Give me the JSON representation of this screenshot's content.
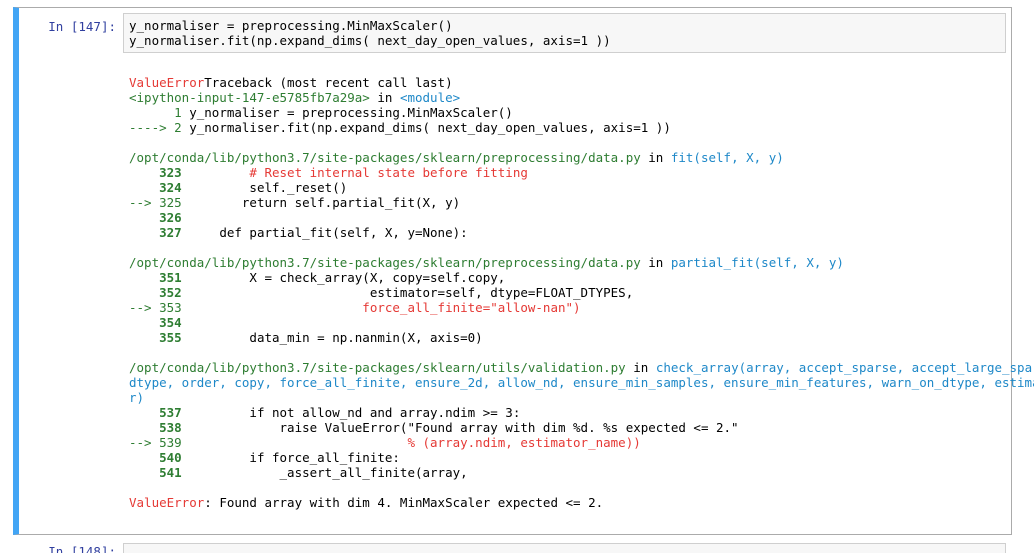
{
  "cell": {
    "prompt": "In [147]:",
    "input_lines": [
      "y_normaliser = preprocessing.MinMaxScaler()",
      "y_normaliser.fit(np.expand_dims( next_day_open_values, axis=1 ))"
    ]
  },
  "traceback": {
    "header_error": "ValueError",
    "header_text": "Traceback (most recent call last)",
    "input_ref": "<ipython-input-147-e5785fb7a29a>",
    "in_kw": " in ",
    "module": "<module>",
    "l1_num": "      1",
    "l1_code": " y_normaliser = preprocessing.MinMaxScaler()",
    "l2_arrow": "----> 2",
    "l2_code": " y_normaliser.fit(np.expand_dims( next_day_open_values, axis=1 ))",
    "f1_path": "/opt/conda/lib/python3.7/site-packages/sklearn/preprocessing/data.py",
    "f1_func": "fit(self, X, y)",
    "f1_323n": "    323",
    "f1_323c": "         # Reset internal state before fitting",
    "f1_324n": "    324",
    "f1_324c": "         self._reset()",
    "f1_325a": "--> 325",
    "f1_325c": "        return self.partial_fit(X, y)",
    "f1_326n": "    326",
    "f1_327n": "    327",
    "f1_327c": "     def partial_fit(self, X, y=None):",
    "f2_path": "/opt/conda/lib/python3.7/site-packages/sklearn/preprocessing/data.py",
    "f2_func": "partial_fit(self, X, y)",
    "f2_351n": "    351",
    "f2_351c": "         X = check_array(X, copy=self.copy,",
    "f2_352n": "    352",
    "f2_352c": "                         estimator=self, dtype=FLOAT_DTYPES,",
    "f2_353a": "--> 353",
    "f2_353c": "                        force_all_finite=\"allow-nan\")",
    "f2_354n": "    354",
    "f2_355n": "    355",
    "f2_355c": "         data_min = np.nanmin(X, axis=0)",
    "f3_path": "/opt/conda/lib/python3.7/site-packages/sklearn/utils/validation.py",
    "f3_func_l1": "check_array(array, accept_sparse, accept_large_sparse,",
    "f3_func_l2": "dtype, order, copy, force_all_finite, ensure_2d, allow_nd, ensure_min_samples, ensure_min_features, warn_on_dtype, estimato",
    "f3_func_l3": "r)",
    "f3_537n": "    537",
    "f3_537c": "         if not allow_nd and array.ndim >= 3:",
    "f3_538n": "    538",
    "f3_538c": "             raise ValueError(\"Found array with dim %d. %s expected <= 2.\"",
    "f3_539a": "--> 539",
    "f3_539c": "                              % (array.ndim, estimator_name))",
    "f3_540n": "    540",
    "f3_540c": "         if force_all_finite:",
    "f3_541n": "    541",
    "f3_541c": "             _assert_all_finite(array,",
    "final_error": "ValueError",
    "final_msg": ": Found array with dim 4. MinMaxScaler expected <= 2."
  },
  "next_cell": {
    "prompt": "In [148]:"
  },
  "colors": {
    "cell_border_accent": "#42a5f5",
    "error_red": "#e53935",
    "line_green": "#2e7d32",
    "func_cyan": "#1e88c8",
    "prompt_blue": "#303f9f"
  }
}
